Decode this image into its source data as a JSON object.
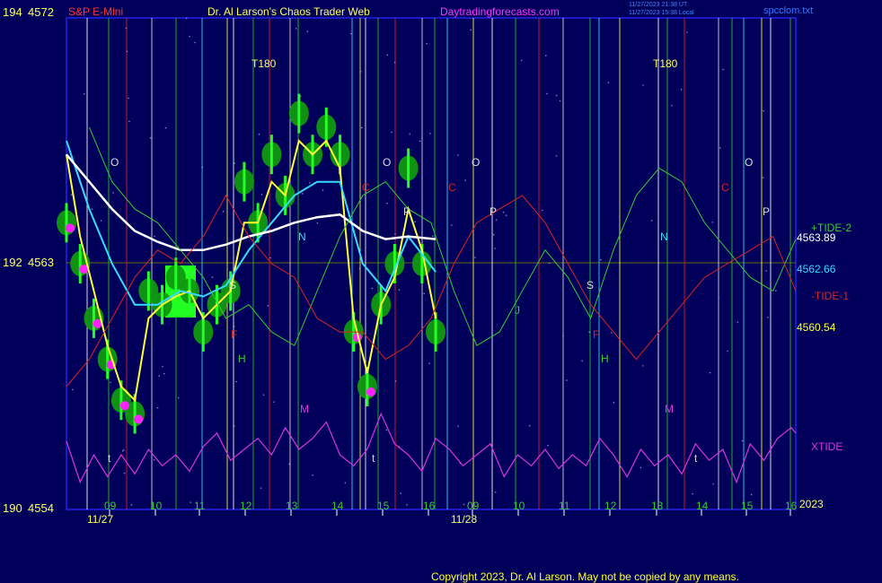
{
  "header": {
    "symbol": "S&P E-Mini",
    "site_title": "Dr. Al Larson's Chaos Trader Web",
    "url": "Daytradingforecasts.com",
    "timestamp_utc": "11/27/2023 21:38 UT",
    "timestamp_local": "11/27/2023 15:38 Local",
    "file": "spcclom.txt",
    "copyright": "Copyright 2023, Dr. Al Larson. May not be copied by any means."
  },
  "colors": {
    "background": "#00005a",
    "frame": "#2222ee",
    "price_bar": "#22ff22",
    "price_ellipse": "#119911",
    "magenta_dots": "#ff22ff",
    "yellow_line": "#ffff33",
    "cyan_line": "#33ddff",
    "white_line": "#ffffff",
    "tide_plus": "#33cc33",
    "tide_minus": "#dd2222",
    "xtide": "#dd33dd"
  },
  "chart_data": {
    "type": "line",
    "title": "S&P E-Mini",
    "y_axis_left": [
      {
        "label": "194",
        "price": "4572"
      },
      {
        "label": "192",
        "price": "4563"
      },
      {
        "label": "190",
        "price": "4554"
      }
    ],
    "ylim": [
      4554,
      4572
    ],
    "x_ticks": [
      "09",
      "10",
      "11",
      "12",
      "13",
      "14",
      "15",
      "16",
      "09",
      "10",
      "11",
      "12",
      "13",
      "14",
      "15",
      "16"
    ],
    "date_labels": [
      "11/27",
      "11/28"
    ],
    "year_label": "2023",
    "right_labels": [
      {
        "text": "+TIDE-2",
        "value": "4563.89",
        "color": "#33cc33"
      },
      {
        "text": "4562.66",
        "color": "#33ddff"
      },
      {
        "text": "-TIDE-1",
        "color": "#dd2222"
      },
      {
        "text": "4560.54",
        "color": "#ffff33"
      },
      {
        "text": "XTIDE",
        "color": "#dd33dd"
      }
    ],
    "t180_labels": [
      "T180",
      "T180"
    ],
    "letter_markers": [
      {
        "text": "O",
        "color": "#dddddd"
      },
      {
        "text": "O",
        "color": "#dddddd"
      },
      {
        "text": "O",
        "color": "#dddddd"
      },
      {
        "text": "O",
        "color": "#dddddd"
      },
      {
        "text": "C",
        "color": "#dd2222"
      },
      {
        "text": "C",
        "color": "#dd2222"
      },
      {
        "text": "C",
        "color": "#dd2222"
      },
      {
        "text": "P",
        "color": "#dddddd"
      },
      {
        "text": "P",
        "color": "#dddddd"
      },
      {
        "text": "P",
        "color": "#dddddd"
      },
      {
        "text": "N",
        "color": "#33ddff"
      },
      {
        "text": "N",
        "color": "#33ddff"
      },
      {
        "text": "S",
        "color": "#dddddd"
      },
      {
        "text": "S",
        "color": "#dddddd"
      },
      {
        "text": "F",
        "color": "#dd2222"
      },
      {
        "text": "F",
        "color": "#dd2222"
      },
      {
        "text": "H",
        "color": "#33cc33"
      },
      {
        "text": "H",
        "color": "#33cc33"
      },
      {
        "text": "J",
        "color": "#33cc33"
      },
      {
        "text": "M",
        "color": "#dd33dd"
      },
      {
        "text": "M",
        "color": "#dd33dd"
      },
      {
        "text": "t",
        "color": "#dddddd"
      },
      {
        "text": "t",
        "color": "#dddddd"
      },
      {
        "text": "t",
        "color": "#dddddd"
      }
    ],
    "series": [
      {
        "name": "price",
        "x": [
          0.0,
          0.3,
          0.6,
          0.9,
          1.2,
          1.5,
          1.8,
          2.1,
          2.4,
          2.7,
          3.0,
          3.3,
          3.6,
          3.9,
          4.2,
          4.5,
          4.8,
          5.1,
          5.4,
          5.7,
          6.0,
          6.3,
          6.6,
          6.9,
          7.2,
          7.5,
          7.8,
          8.1
        ],
        "y": [
          4564.5,
          4563.0,
          4561.0,
          4559.5,
          4558.0,
          4557.5,
          4562.0,
          4561.5,
          4562.5,
          4562.0,
          4560.5,
          4561.5,
          4562.0,
          4566.0,
          4564.5,
          4567.0,
          4565.5,
          4568.5,
          4567.0,
          4568.0,
          4567.0,
          4560.5,
          4558.5,
          4561.5,
          4563.0,
          4566.5,
          4563.0,
          4560.5
        ]
      },
      {
        "name": "yellow",
        "x": [
          0.0,
          0.3,
          0.6,
          0.9,
          1.2,
          1.5,
          1.8,
          2.1,
          2.4,
          2.7,
          3.0,
          3.3,
          3.6,
          3.9,
          4.2,
          4.5,
          4.8,
          5.1,
          5.4,
          5.7,
          6.0,
          6.3,
          6.6,
          6.9,
          7.2,
          7.5,
          7.8,
          8.1
        ],
        "y": [
          4567.0,
          4564.0,
          4562.0,
          4560.0,
          4558.5,
          4558.0,
          4561.0,
          4561.5,
          4561.8,
          4562.0,
          4561.0,
          4561.5,
          4562.0,
          4564.5,
          4564.5,
          4566.0,
          4565.5,
          4567.5,
          4567.0,
          4567.5,
          4566.5,
          4561.0,
          4559.0,
          4561.5,
          4562.5,
          4565.0,
          4563.5,
          4561.0
        ]
      },
      {
        "name": "cyan",
        "x": [
          0.0,
          0.5,
          1.0,
          1.5,
          2.0,
          2.5,
          3.0,
          3.5,
          4.0,
          4.5,
          5.0,
          5.5,
          6.0,
          6.5,
          7.0,
          7.5,
          8.1
        ],
        "y": [
          4567.5,
          4565.0,
          4563.0,
          4561.5,
          4561.5,
          4562.0,
          4561.8,
          4562.2,
          4563.5,
          4564.5,
          4565.5,
          4566.0,
          4566.0,
          4563.0,
          4562.0,
          4564.0,
          4562.7
        ]
      },
      {
        "name": "white",
        "x": [
          0.0,
          0.5,
          1.0,
          1.5,
          2.0,
          2.5,
          3.0,
          3.5,
          4.0,
          4.5,
          5.0,
          5.5,
          6.0,
          6.5,
          7.0,
          7.5,
          8.1
        ],
        "y": [
          4567.0,
          4566.0,
          4565.0,
          4564.2,
          4563.8,
          4563.5,
          4563.5,
          4563.7,
          4564.0,
          4564.2,
          4564.5,
          4564.7,
          4564.8,
          4564.2,
          4563.9,
          4564.0,
          4563.9
        ]
      },
      {
        "name": "+TIDE-2",
        "x": [
          0.5,
          1.0,
          1.5,
          2.0,
          2.5,
          3.0,
          3.5,
          4.0,
          4.5,
          5.0,
          5.5,
          6.0,
          6.5,
          7.0,
          7.5,
          8.0,
          8.5,
          9.0,
          9.5,
          10.0,
          10.5,
          11.0,
          11.5,
          12.0,
          12.5,
          13.0,
          13.5,
          14.0,
          14.5,
          15.0,
          15.5,
          16.0
        ],
        "y": [
          4568.0,
          4566.0,
          4565.0,
          4564.5,
          4563.5,
          4562.5,
          4561.0,
          4561.5,
          4560.5,
          4560.0,
          4562.0,
          4564.0,
          4565.5,
          4566.0,
          4565.0,
          4564.5,
          4562.0,
          4560.0,
          4560.5,
          4562.0,
          4563.5,
          4562.5,
          4561.0,
          4563.5,
          4565.5,
          4566.5,
          4566.0,
          4564.5,
          4563.5,
          4562.5,
          4562.0,
          4563.9
        ]
      },
      {
        "name": "-TIDE-1",
        "x": [
          0.0,
          0.5,
          1.0,
          1.5,
          2.0,
          2.5,
          3.0,
          3.5,
          4.0,
          4.5,
          5.0,
          5.5,
          6.0,
          6.5,
          7.0,
          7.5,
          8.0,
          8.5,
          9.0,
          9.5,
          10.0,
          10.5,
          11.0,
          11.5,
          12.0,
          12.5,
          13.0,
          13.5,
          14.0,
          14.5,
          15.0,
          15.5,
          16.0
        ],
        "y": [
          4558.5,
          4559.5,
          4561.0,
          4562.5,
          4563.5,
          4563.0,
          4564.0,
          4565.5,
          4564.0,
          4563.0,
          4562.5,
          4561.0,
          4560.5,
          4560.5,
          4559.5,
          4560.0,
          4561.0,
          4563.0,
          4564.5,
          4565.0,
          4565.5,
          4564.5,
          4563.0,
          4561.5,
          4560.5,
          4559.5,
          4560.5,
          4561.5,
          4562.5,
          4563.0,
          4563.5,
          4564.0,
          4562.0
        ]
      },
      {
        "name": "XTIDE",
        "x": [
          0.0,
          0.3,
          0.6,
          0.9,
          1.2,
          1.5,
          1.8,
          2.1,
          2.4,
          2.7,
          3.0,
          3.3,
          3.6,
          3.9,
          4.2,
          4.5,
          4.8,
          5.1,
          5.4,
          5.7,
          6.0,
          6.3,
          6.6,
          6.9,
          7.2,
          7.5,
          7.8,
          8.1,
          8.4,
          8.7,
          9.0,
          9.3,
          9.6,
          9.9,
          10.2,
          10.5,
          10.8,
          11.1,
          11.4,
          11.7,
          12.0,
          12.3,
          12.6,
          12.9,
          13.2,
          13.5,
          13.8,
          14.1,
          14.4,
          14.7,
          15.0,
          15.3,
          15.6,
          15.9,
          16.0
        ],
        "y": [
          4556.5,
          4555.0,
          4556.0,
          4555.2,
          4556.0,
          4555.3,
          4556.2,
          4555.6,
          4556.0,
          4555.4,
          4556.3,
          4556.8,
          4555.8,
          4556.2,
          4556.6,
          4556.0,
          4557.0,
          4556.2,
          4556.6,
          4557.2,
          4556.0,
          4555.6,
          4556.2,
          4557.5,
          4556.4,
          4556.0,
          4555.4,
          4556.6,
          4556.2,
          4555.6,
          4556.0,
          4556.4,
          4555.2,
          4556.0,
          4555.6,
          4556.2,
          4555.5,
          4556.0,
          4555.6,
          4556.6,
          4556.0,
          4555.2,
          4556.2,
          4555.6,
          4556.0,
          4555.3,
          4556.4,
          4555.8,
          4556.2,
          4555.0,
          4556.4,
          4555.8,
          4556.6,
          4557.0,
          4556.8
        ]
      }
    ]
  }
}
